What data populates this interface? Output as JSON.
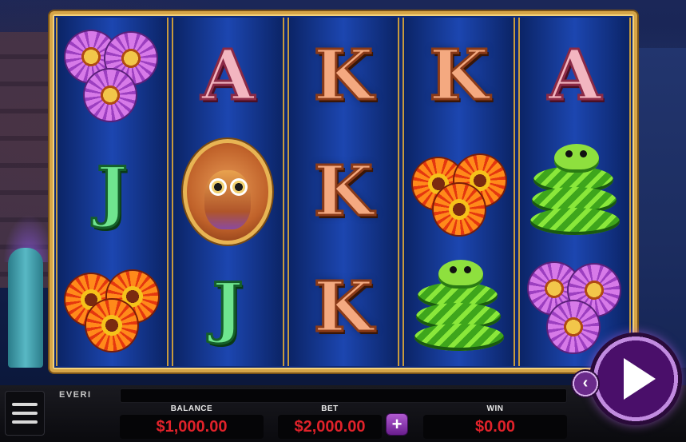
{
  "logo": {
    "text": "EVERI"
  },
  "reels": [
    [
      {
        "type": "flower",
        "variant": "purple",
        "name": "purple-flowers"
      },
      {
        "type": "letter",
        "letter": "J",
        "cls": "j"
      },
      {
        "type": "flower",
        "variant": "orange",
        "name": "orange-flowers"
      }
    ],
    [
      {
        "type": "letter",
        "letter": "A",
        "cls": "a"
      },
      {
        "type": "owl",
        "name": "owl"
      },
      {
        "type": "letter",
        "letter": "J",
        "cls": "j"
      }
    ],
    [
      {
        "type": "letter",
        "letter": "K",
        "cls": "k"
      },
      {
        "type": "letter",
        "letter": "K",
        "cls": "k"
      },
      {
        "type": "letter",
        "letter": "K",
        "cls": "k"
      }
    ],
    [
      {
        "type": "letter",
        "letter": "K",
        "cls": "k"
      },
      {
        "type": "flower",
        "variant": "orange",
        "name": "orange-flowers"
      },
      {
        "type": "snake",
        "name": "snake"
      }
    ],
    [
      {
        "type": "letter",
        "letter": "A",
        "cls": "a"
      },
      {
        "type": "snake",
        "name": "snake"
      },
      {
        "type": "flower",
        "variant": "purple",
        "name": "purple-flowers"
      }
    ]
  ],
  "stats": {
    "balance": {
      "label": "BALANCE",
      "value": "$1,000.00"
    },
    "bet": {
      "label": "BET",
      "value": "$2,000.00"
    },
    "win": {
      "label": "WIN",
      "value": "$0.00"
    }
  },
  "controls": {
    "plus_label": "+",
    "prev_label": "‹"
  },
  "colors": {
    "frame_gold": "#d6a548",
    "reel_blue": "#1c46b0",
    "value_red": "#e0222a",
    "spin_purple": "#4a0f6a"
  }
}
